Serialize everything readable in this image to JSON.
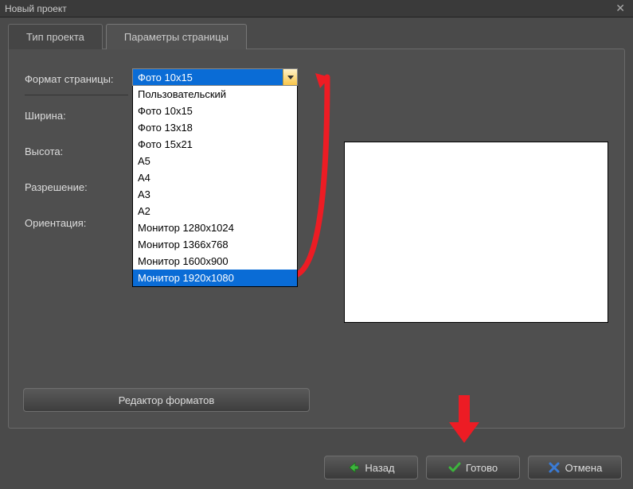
{
  "window": {
    "title": "Новый проект"
  },
  "tabs": {
    "project_type": "Тип проекта",
    "page_params": "Параметры страницы"
  },
  "labels": {
    "page_format": "Формат страницы:",
    "width": "Ширина:",
    "height": "Высота:",
    "resolution": "Разрешение:",
    "orientation": "Ориентация:"
  },
  "dropdown": {
    "selected": "Фото 10x15",
    "highlighted": "Монитор 1920x1080",
    "options": [
      "Пользовательский",
      "Фото 10x15",
      "Фото 13x18",
      "Фото 15x21",
      "A5",
      "A4",
      "A3",
      "A2",
      "Монитор 1280x1024",
      "Монитор 1366x768",
      "Монитор 1600x900",
      "Монитор 1920x1080"
    ]
  },
  "buttons": {
    "format_editor": "Редактор форматов",
    "back": "Назад",
    "done": "Готово",
    "cancel": "Отмена"
  },
  "colors": {
    "highlight": "#0a6cd6",
    "annotation": "#ed1c24"
  }
}
